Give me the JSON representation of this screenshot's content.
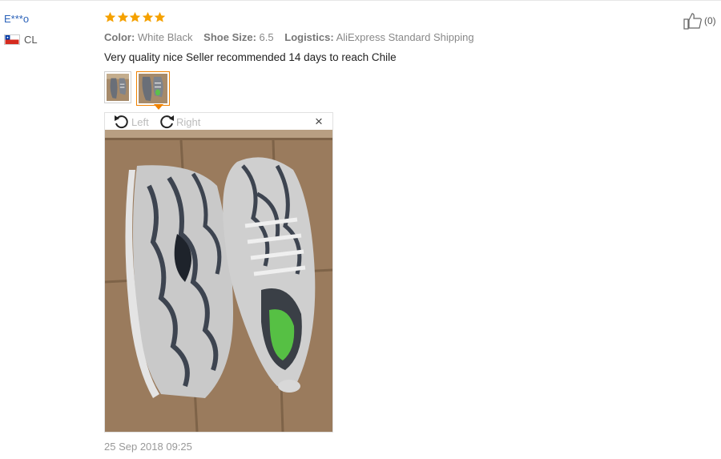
{
  "reviewer": {
    "name": "E***o",
    "country_code": "CL",
    "flag_icon": "chile-flag-icon"
  },
  "rating": {
    "stars": 5,
    "max": 5,
    "color": "#f5a100"
  },
  "attributes": [
    {
      "key": "Color:",
      "value": "White Black"
    },
    {
      "key": "Shoe Size:",
      "value": "6.5"
    },
    {
      "key": "Logistics:",
      "value": "AliExpress Standard Shipping"
    }
  ],
  "review": {
    "text": "Very quality nice Seller recommended 14 days to reach Chile"
  },
  "photos": {
    "count": 2,
    "selected_index": 1,
    "accent": "#f08200"
  },
  "viewer": {
    "rotate_left_label": "Left",
    "rotate_right_label": "Right",
    "close_label": "×"
  },
  "date": "25 Sep 2018 09:25",
  "helpful": {
    "icon": "thumbs-up-icon",
    "count_label": "(0)"
  }
}
